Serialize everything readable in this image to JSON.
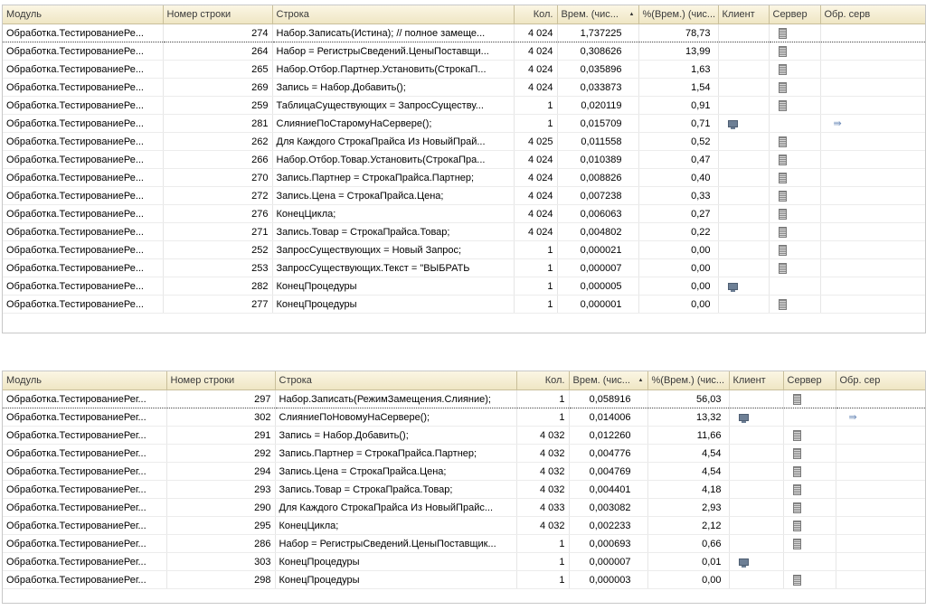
{
  "table1": {
    "headers": [
      "Модуль",
      "Номер строки",
      "Строка",
      "Кол.",
      "Врем. (чис...",
      "%(Врем.) (чис...",
      "Клиент",
      "Сервер",
      "Обр. серв"
    ],
    "rows": [
      {
        "module": "Обработка.ТестированиеРе...",
        "line": "274",
        "code": "Набор.Записать(Истина); // полное замеще...",
        "count": "4 024",
        "time": "1,737225",
        "pct": "78,73",
        "client": false,
        "server": true,
        "srvcall": false
      },
      {
        "module": "Обработка.ТестированиеРе...",
        "line": "264",
        "code": "Набор = РегистрыСведений.ЦеныПоставщи...",
        "count": "4 024",
        "time": "0,308626",
        "pct": "13,99",
        "client": false,
        "server": true,
        "srvcall": false
      },
      {
        "module": "Обработка.ТестированиеРе...",
        "line": "265",
        "code": "Набор.Отбор.Партнер.Установить(СтрокаП...",
        "count": "4 024",
        "time": "0,035896",
        "pct": "1,63",
        "client": false,
        "server": true,
        "srvcall": false
      },
      {
        "module": "Обработка.ТестированиеРе...",
        "line": "269",
        "code": "Запись = Набор.Добавить();",
        "count": "4 024",
        "time": "0,033873",
        "pct": "1,54",
        "client": false,
        "server": true,
        "srvcall": false
      },
      {
        "module": "Обработка.ТестированиеРе...",
        "line": "259",
        "code": "ТаблицаСуществующих = ЗапросСуществу...",
        "count": "1",
        "time": "0,020119",
        "pct": "0,91",
        "client": false,
        "server": true,
        "srvcall": false
      },
      {
        "module": "Обработка.ТестированиеРе...",
        "line": "281",
        "code": "СлияниеПоСтаромуНаСервере();",
        "count": "1",
        "time": "0,015709",
        "pct": "0,71",
        "client": true,
        "server": false,
        "srvcall": true
      },
      {
        "module": "Обработка.ТестированиеРе...",
        "line": "262",
        "code": "Для Каждого СтрокаПрайса Из НовыйПрай...",
        "count": "4 025",
        "time": "0,011558",
        "pct": "0,52",
        "client": false,
        "server": true,
        "srvcall": false
      },
      {
        "module": "Обработка.ТестированиеРе...",
        "line": "266",
        "code": "Набор.Отбор.Товар.Установить(СтрокаПра...",
        "count": "4 024",
        "time": "0,010389",
        "pct": "0,47",
        "client": false,
        "server": true,
        "srvcall": false
      },
      {
        "module": "Обработка.ТестированиеРе...",
        "line": "270",
        "code": "Запись.Партнер = СтрокаПрайса.Партнер;",
        "count": "4 024",
        "time": "0,008826",
        "pct": "0,40",
        "client": false,
        "server": true,
        "srvcall": false
      },
      {
        "module": "Обработка.ТестированиеРе...",
        "line": "272",
        "code": "Запись.Цена      = СтрокаПрайса.Цена;",
        "count": "4 024",
        "time": "0,007238",
        "pct": "0,33",
        "client": false,
        "server": true,
        "srvcall": false
      },
      {
        "module": "Обработка.ТестированиеРе...",
        "line": "276",
        "code": "КонецЦикла;",
        "count": "4 024",
        "time": "0,006063",
        "pct": "0,27",
        "client": false,
        "server": true,
        "srvcall": false
      },
      {
        "module": "Обработка.ТестированиеРе...",
        "line": "271",
        "code": "Запись.Товар     = СтрокаПрайса.Товар;",
        "count": "4 024",
        "time": "0,004802",
        "pct": "0,22",
        "client": false,
        "server": true,
        "srvcall": false
      },
      {
        "module": "Обработка.ТестированиеРе...",
        "line": "252",
        "code": "ЗапросСуществующих = Новый Запрос;",
        "count": "1",
        "time": "0,000021",
        "pct": "0,00",
        "client": false,
        "server": true,
        "srvcall": false
      },
      {
        "module": "Обработка.ТестированиеРе...",
        "line": "253",
        "code": "ЗапросСуществующих.Текст = \"ВЫБРАТЬ",
        "count": "1",
        "time": "0,000007",
        "pct": "0,00",
        "client": false,
        "server": true,
        "srvcall": false
      },
      {
        "module": "Обработка.ТестированиеРе...",
        "line": "282",
        "code": "КонецПроцедуры",
        "count": "1",
        "time": "0,000005",
        "pct": "0,00",
        "client": true,
        "server": false,
        "srvcall": false
      },
      {
        "module": "Обработка.ТестированиеРе...",
        "line": "277",
        "code": "КонецПроцедуры",
        "count": "1",
        "time": "0,000001",
        "pct": "0,00",
        "client": false,
        "server": true,
        "srvcall": false
      }
    ]
  },
  "table2": {
    "headers": [
      "Модуль",
      "Номер строки",
      "Строка",
      "Кол.",
      "Врем. (чис...",
      "%(Врем.) (чис...",
      "Клиент",
      "Сервер",
      "Обр. сер"
    ],
    "rows": [
      {
        "module": "Обработка.ТестированиеРег...",
        "line": "297",
        "code": "Набор.Записать(РежимЗамещения.Слияние);",
        "count": "1",
        "time": "0,058916",
        "pct": "56,03",
        "client": false,
        "server": true,
        "srvcall": false
      },
      {
        "module": "Обработка.ТестированиеРег...",
        "line": "302",
        "code": "СлияниеПоНовомуНаСервере();",
        "count": "1",
        "time": "0,014006",
        "pct": "13,32",
        "client": true,
        "server": false,
        "srvcall": true
      },
      {
        "module": "Обработка.ТестированиеРег...",
        "line": "291",
        "code": "Запись = Набор.Добавить();",
        "count": "4 032",
        "time": "0,012260",
        "pct": "11,66",
        "client": false,
        "server": true,
        "srvcall": false
      },
      {
        "module": "Обработка.ТестированиеРег...",
        "line": "292",
        "code": "Запись.Партнер = СтрокаПрайса.Партнер;",
        "count": "4 032",
        "time": "0,004776",
        "pct": "4,54",
        "client": false,
        "server": true,
        "srvcall": false
      },
      {
        "module": "Обработка.ТестированиеРег...",
        "line": "294",
        "code": "Запись.Цена      = СтрокаПрайса.Цена;",
        "count": "4 032",
        "time": "0,004769",
        "pct": "4,54",
        "client": false,
        "server": true,
        "srvcall": false
      },
      {
        "module": "Обработка.ТестированиеРег...",
        "line": "293",
        "code": "Запись.Товар     = СтрокаПрайса.Товар;",
        "count": "4 032",
        "time": "0,004401",
        "pct": "4,18",
        "client": false,
        "server": true,
        "srvcall": false
      },
      {
        "module": "Обработка.ТестированиеРег...",
        "line": "290",
        "code": "Для Каждого СтрокаПрайса Из НовыйПрайс...",
        "count": "4 033",
        "time": "0,003082",
        "pct": "2,93",
        "client": false,
        "server": true,
        "srvcall": false
      },
      {
        "module": "Обработка.ТестированиеРег...",
        "line": "295",
        "code": "КонецЦикла;",
        "count": "4 032",
        "time": "0,002233",
        "pct": "2,12",
        "client": false,
        "server": true,
        "srvcall": false
      },
      {
        "module": "Обработка.ТестированиеРег...",
        "line": "286",
        "code": "Набор = РегистрыСведений.ЦеныПоставщик...",
        "count": "1",
        "time": "0,000693",
        "pct": "0,66",
        "client": false,
        "server": true,
        "srvcall": false
      },
      {
        "module": "Обработка.ТестированиеРег...",
        "line": "303",
        "code": "КонецПроцедуры",
        "count": "1",
        "time": "0,000007",
        "pct": "0,01",
        "client": true,
        "server": false,
        "srvcall": false
      },
      {
        "module": "Обработка.ТестированиеРег...",
        "line": "298",
        "code": "КонецПроцедуры",
        "count": "1",
        "time": "0,000003",
        "pct": "0,00",
        "client": false,
        "server": true,
        "srvcall": false
      }
    ]
  }
}
